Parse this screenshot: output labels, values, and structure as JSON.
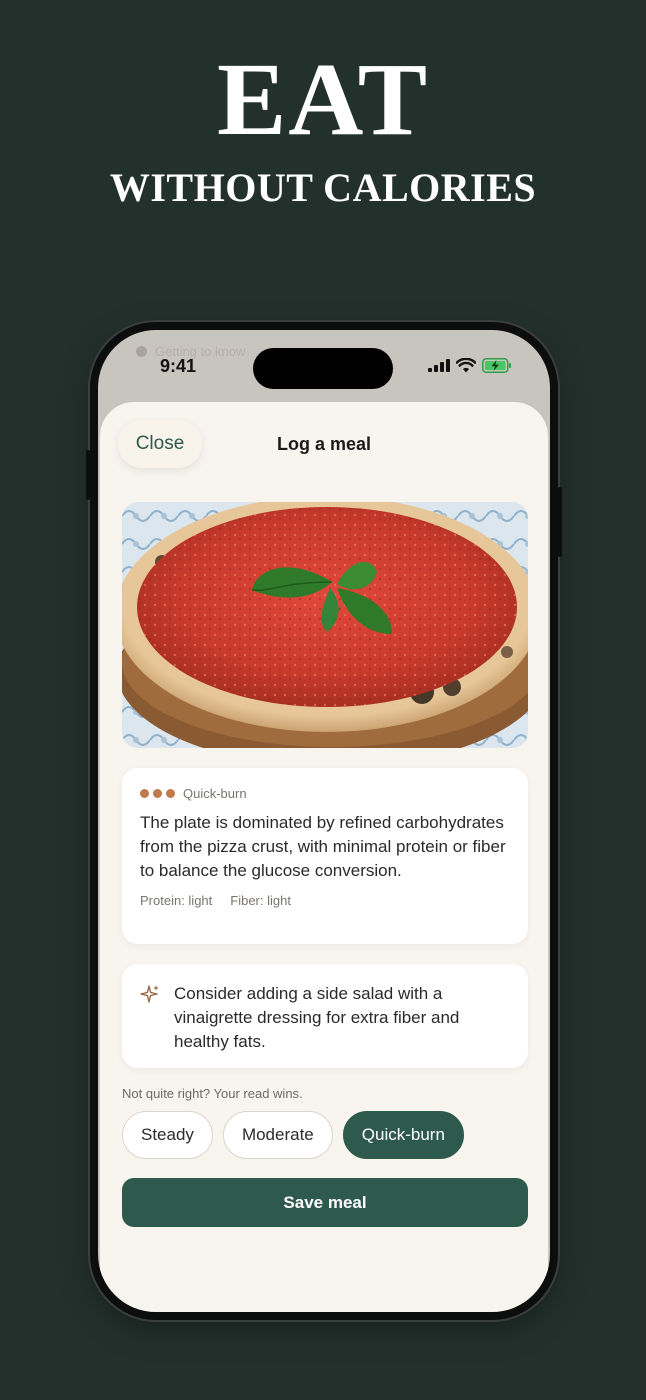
{
  "marketing": {
    "headline": "EAT",
    "subheadline": "WITHOUT CALORIES"
  },
  "status_bar": {
    "time": "9:41",
    "underlay_text": "Getting to know"
  },
  "sheet": {
    "close_label": "Close",
    "title": "Log a meal"
  },
  "meal_photo": {
    "icon": "pizza-photo"
  },
  "analysis_card": {
    "category": "Quick-burn",
    "summary": "The plate is dominated by refined carbohydrates from the pizza crust, with minimal protein or fiber to balance the glucose conversion.",
    "protein": "Protein: light",
    "fiber": "Fiber: light"
  },
  "tip_card": {
    "icon": "sparkle-icon",
    "text": "Consider adding a side salad with a vinaigrette dressing for extra fiber and healthy fats."
  },
  "override": {
    "hint": "Not quite right? Your read wins.",
    "options": [
      "Steady",
      "Moderate",
      "Quick-burn"
    ],
    "selected": "Quick-burn"
  },
  "actions": {
    "save_label": "Save meal"
  },
  "colors": {
    "background": "#23312c",
    "accent": "#2e5a4d",
    "burn_dots": "#c07a4e",
    "sheet": "#f8f5ef"
  }
}
